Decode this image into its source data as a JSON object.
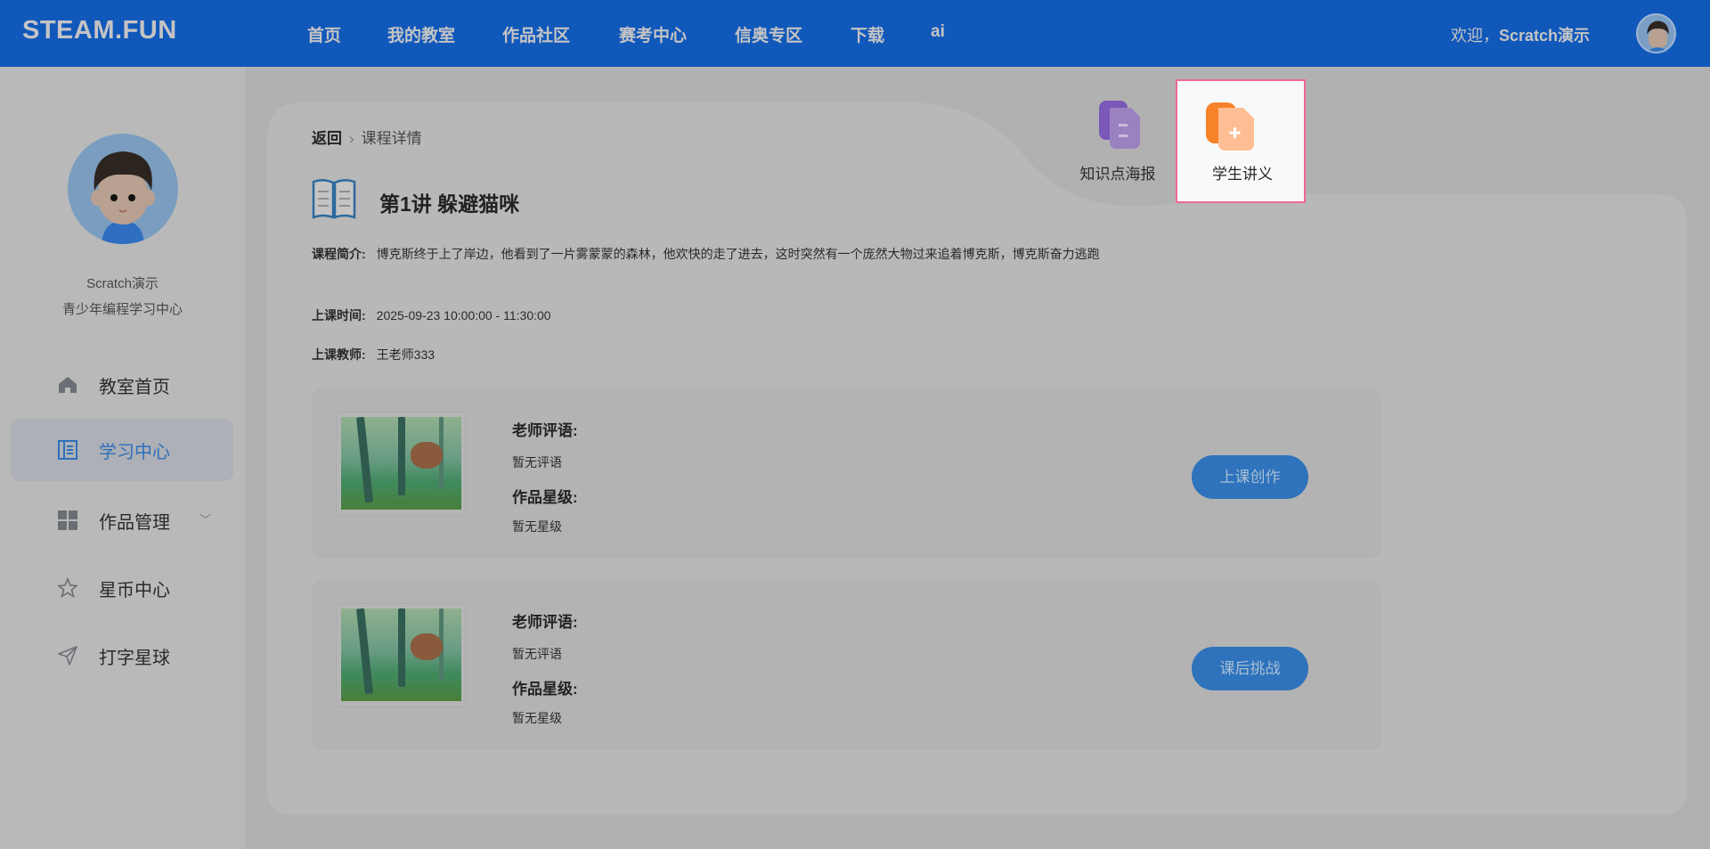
{
  "header": {
    "logo": "STEAM.FUN",
    "nav": [
      "首页",
      "我的教室",
      "作品社区",
      "赛考中心",
      "信奥专区",
      "下载",
      "ai"
    ],
    "welcome_prefix": "欢迎，",
    "username": "Scratch演示"
  },
  "sidebar": {
    "name": "Scratch演示",
    "org": "青少年编程学习中心",
    "items": [
      {
        "label": "教室首页",
        "icon": "home-icon"
      },
      {
        "label": "学习中心",
        "icon": "notebook-icon",
        "active": true
      },
      {
        "label": "作品管理",
        "icon": "grid-icon"
      },
      {
        "label": "星币中心",
        "icon": "star-icon"
      },
      {
        "label": "打字星球",
        "icon": "send-icon"
      }
    ]
  },
  "breadcrumb": {
    "back": "返回",
    "current": "课程详情"
  },
  "tools": [
    {
      "label": "知识点海报",
      "icon": "poster-doc-icon"
    },
    {
      "label": "学生讲义",
      "icon": "handout-doc-icon",
      "highlighted": true
    }
  ],
  "course": {
    "title": "第1讲 躲避猫咪",
    "intro_label": "课程简介:",
    "intro": "博克斯终于上了岸边，他看到了一片雾蒙蒙的森林，他欢快的走了进去，这时突然有一个庞然大物过来追着博克斯，博克斯奋力逃跑",
    "time_label": "上课时间:",
    "time": "2025-09-23 10:00:00 - 11:30:00",
    "teacher_label": "上课教师:",
    "teacher": "王老师333"
  },
  "lessons": [
    {
      "comment_label": "老师评语:",
      "comment": "暂无评语",
      "rating_label": "作品星级:",
      "rating": "暂无星级",
      "button": "上课创作"
    },
    {
      "comment_label": "老师评语:",
      "comment": "暂无评语",
      "rating_label": "作品星级:",
      "rating": "暂无星级",
      "button": "课后挑战"
    }
  ],
  "colors": {
    "header": "#1158bb",
    "accent": "#2e73bc",
    "highlight_border": "#f06895"
  }
}
